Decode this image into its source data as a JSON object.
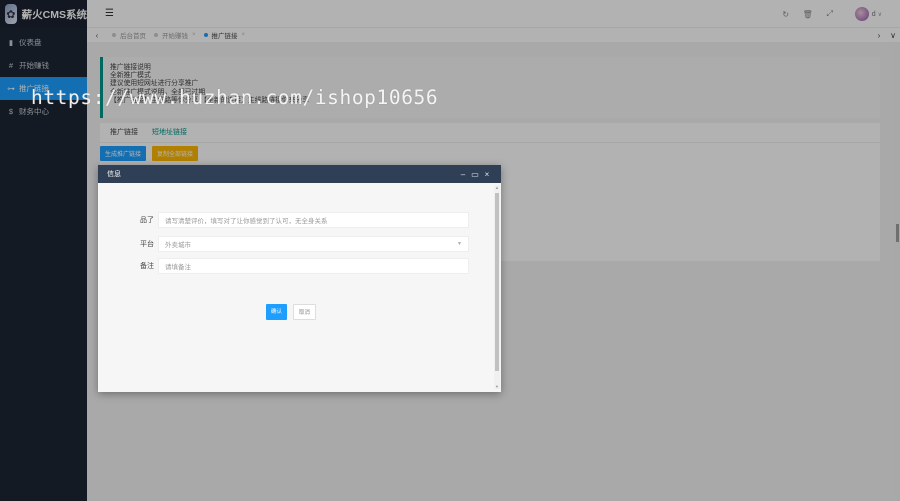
{
  "sidebar": {
    "brand_logo_icon": "bunny-logo",
    "brand_title": "薪火CMS系统",
    "items": [
      {
        "icon": "bookmark-icon",
        "glyph": "▮",
        "label": "仪表盘",
        "active": false
      },
      {
        "icon": "hash-icon",
        "glyph": "#",
        "label": "开始赚钱",
        "active": false
      },
      {
        "icon": "share-icon",
        "glyph": "⊶",
        "label": "推广链接",
        "active": true
      },
      {
        "icon": "dollar-icon",
        "glyph": "$",
        "label": "财务中心",
        "active": false
      }
    ]
  },
  "header": {
    "menu_icon": "☰",
    "refresh_icon": "↻",
    "trash_icon": "🗑",
    "fullscreen_icon": "⤢",
    "user_name": "d",
    "user_chevron": "∨"
  },
  "tabs": {
    "prev": "‹",
    "next": "›",
    "more": "∨",
    "items": [
      {
        "label": "后台首页",
        "active": false,
        "closable": false
      },
      {
        "label": "开始赚钱",
        "active": false,
        "closable": true
      },
      {
        "label": "推广链接",
        "active": true,
        "closable": true
      }
    ]
  },
  "note": {
    "lines": [
      "推广链接说明",
      "全新推广模式",
      "建议使用短网址进行分享推广",
      "全新推广模式说明，全部已过期",
      "【推广链接】主线路等你分享 【全新的连接】主线路链接你来分享"
    ]
  },
  "card": {
    "tabs": [
      {
        "label": "推广链接",
        "active": false
      },
      {
        "label": "短地址链接",
        "active": true
      }
    ],
    "buttons": [
      {
        "label": "生成推广链接",
        "color": "#1e9fff"
      },
      {
        "label": "复制全部链接",
        "color": "#ffb800"
      }
    ]
  },
  "watermark": "https://www.huzhan.com/ishop10656",
  "modal": {
    "title": "信息",
    "controls": [
      "–",
      "▭",
      "×"
    ],
    "fields": [
      {
        "label": "品了",
        "value": "请写清楚评价，填写对了让你感觉到了认可，无全身关系"
      },
      {
        "label": "平台",
        "value": "外卖城市",
        "type": "select",
        "arrow": "▼"
      },
      {
        "label": "备注",
        "value": "请填备注"
      }
    ],
    "ok_label": "确认",
    "cancel_label": "取消",
    "scroll_up": "▲",
    "scroll_down": "▼"
  }
}
